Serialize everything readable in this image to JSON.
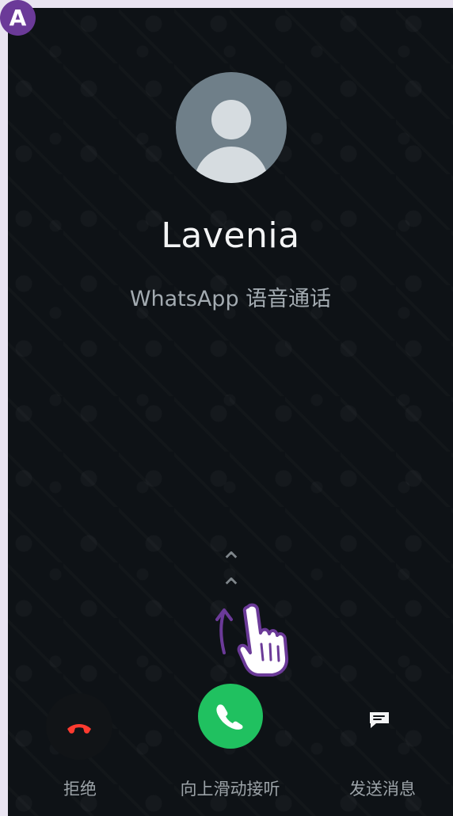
{
  "badge": "A",
  "caller": {
    "name": "Lavenia",
    "subtitle": "WhatsApp 语音通话"
  },
  "hint": {
    "swipe_direction": "up"
  },
  "actions": {
    "decline_label": "拒绝",
    "accept_label": "向上滑动接听",
    "message_label": "发送消息"
  },
  "colors": {
    "background": "#0e1216",
    "accept": "#20c160",
    "decline_icon": "#ff3b30",
    "badge": "#6b3a98",
    "annotation": "#6b3a98"
  },
  "icons": {
    "avatar": "default-person-icon",
    "decline": "phone-hangup-icon",
    "accept": "phone-icon",
    "message": "message-icon"
  }
}
